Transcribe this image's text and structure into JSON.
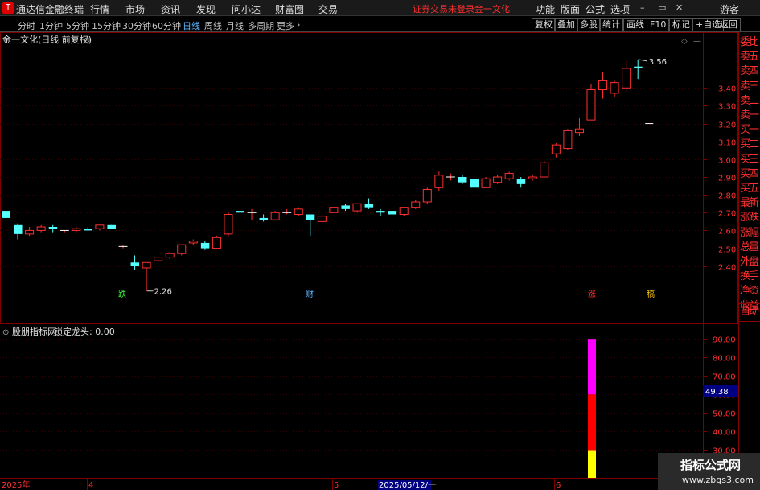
{
  "menubar": {
    "app_title": "通达信金融终端",
    "items": [
      "行情",
      "市场",
      "资讯",
      "发现",
      "问小达",
      "财富圈",
      "交易"
    ],
    "status": "证券交易未登录",
    "stock_name": "金一文化",
    "right_items": [
      "功能",
      "版面",
      "公式",
      "选项"
    ],
    "guest": "游客",
    "win_min": "–",
    "win_restore": "▭",
    "win_close": "✕"
  },
  "toolbar": {
    "periods": [
      "分时",
      "1分钟",
      "5分钟",
      "15分钟",
      "30分钟",
      "60分钟",
      "日线",
      "周线",
      "月线",
      "多周期",
      "更多"
    ],
    "active_period": "日线",
    "right_buttons": [
      "复权",
      "叠加",
      "多股",
      "统计",
      "画线",
      "F10",
      "标记",
      "+自选",
      "返回"
    ]
  },
  "main_chart": {
    "title": "金一文化(日线 前复权)",
    "y_ticks": [
      "3.40",
      "3.30",
      "3.20",
      "3.10",
      "3.00",
      "2.90",
      "2.80",
      "2.70",
      "2.60",
      "2.50",
      "2.40"
    ],
    "high_label": "3.56",
    "low_label": "2.26",
    "markers": [
      {
        "text": "跌",
        "color": "#3cff3c"
      },
      {
        "text": "财",
        "color": "#5ab4ff"
      },
      {
        "text": "涨",
        "color": "#ff3030"
      },
      {
        "text": "稿",
        "color": "#ffcc00"
      }
    ]
  },
  "indicator": {
    "name": "股朋指标网",
    "line_label": "锁定龙头: 0.00",
    "y_ticks": [
      "90.00",
      "80.00",
      "70.00",
      "60.00",
      "50.00",
      "40.00",
      "30.00"
    ],
    "current_value": "49.38",
    "bar_segments": [
      {
        "from": 0,
        "to": 30,
        "color": "#ffff00"
      },
      {
        "from": 30,
        "to": 60,
        "color": "#ff0000"
      },
      {
        "from": 60,
        "to": 90,
        "color": "#ff00ff"
      }
    ]
  },
  "date_axis": [
    "2025年",
    "4",
    "5",
    "2025/05/12/一",
    "6"
  ],
  "right_panel": [
    "委比",
    "卖五",
    "卖四",
    "卖三",
    "卖二",
    "卖一",
    "买一",
    "买二",
    "买三",
    "买四",
    "买五",
    "最新",
    "涨跌",
    "涨幅",
    "总量",
    "外盘",
    "换手",
    "净资",
    "收益",
    "自动"
  ],
  "watermark": {
    "line1": "指标公式网",
    "line2": "www.zbgs3.com"
  },
  "colors": {
    "up": "#ff3030",
    "down": "#54ffff",
    "grid": "#800000",
    "axis_text": "#ff3030",
    "bg": "#000000"
  },
  "chart_data": {
    "type": "candlestick",
    "ylim": [
      2.2,
      3.6
    ],
    "candles": [
      {
        "o": 2.71,
        "h": 2.74,
        "l": 2.66,
        "c": 2.67
      },
      {
        "o": 2.63,
        "h": 2.64,
        "l": 2.55,
        "c": 2.58
      },
      {
        "o": 2.58,
        "h": 2.62,
        "l": 2.57,
        "c": 2.6
      },
      {
        "o": 2.6,
        "h": 2.63,
        "l": 2.59,
        "c": 2.62
      },
      {
        "o": 2.62,
        "h": 2.63,
        "l": 2.59,
        "c": 2.61
      },
      {
        "o": 2.6,
        "h": 2.6,
        "l": 2.59,
        "c": 2.6
      },
      {
        "o": 2.6,
        "h": 2.62,
        "l": 2.59,
        "c": 2.61
      },
      {
        "o": 2.61,
        "h": 2.62,
        "l": 2.6,
        "c": 2.6
      },
      {
        "o": 2.61,
        "h": 2.63,
        "l": 2.6,
        "c": 2.63
      },
      {
        "o": 2.63,
        "h": 2.63,
        "l": 2.61,
        "c": 2.61
      },
      {
        "o": 2.51,
        "h": 2.52,
        "l": 2.5,
        "c": 2.51
      },
      {
        "o": 2.42,
        "h": 2.46,
        "l": 2.38,
        "c": 2.4
      },
      {
        "o": 2.39,
        "h": 2.42,
        "l": 2.26,
        "c": 2.42
      },
      {
        "o": 2.43,
        "h": 2.45,
        "l": 2.42,
        "c": 2.45
      },
      {
        "o": 2.45,
        "h": 2.48,
        "l": 2.44,
        "c": 2.47
      },
      {
        "o": 2.47,
        "h": 2.52,
        "l": 2.46,
        "c": 2.52
      },
      {
        "o": 2.53,
        "h": 2.55,
        "l": 2.52,
        "c": 2.54
      },
      {
        "o": 2.53,
        "h": 2.54,
        "l": 2.49,
        "c": 2.5
      },
      {
        "o": 2.5,
        "h": 2.57,
        "l": 2.5,
        "c": 2.56
      },
      {
        "o": 2.58,
        "h": 2.7,
        "l": 2.57,
        "c": 2.69
      },
      {
        "o": 2.71,
        "h": 2.74,
        "l": 2.68,
        "c": 2.7
      },
      {
        "o": 2.7,
        "h": 2.72,
        "l": 2.66,
        "c": 2.7
      },
      {
        "o": 2.67,
        "h": 2.69,
        "l": 2.65,
        "c": 2.66
      },
      {
        "o": 2.66,
        "h": 2.71,
        "l": 2.66,
        "c": 2.7
      },
      {
        "o": 2.7,
        "h": 2.72,
        "l": 2.69,
        "c": 2.7
      },
      {
        "o": 2.69,
        "h": 2.73,
        "l": 2.68,
        "c": 2.72
      },
      {
        "o": 2.69,
        "h": 2.69,
        "l": 2.57,
        "c": 2.66
      },
      {
        "o": 2.65,
        "h": 2.69,
        "l": 2.65,
        "c": 2.68
      },
      {
        "o": 2.7,
        "h": 2.73,
        "l": 2.7,
        "c": 2.73
      },
      {
        "o": 2.74,
        "h": 2.75,
        "l": 2.71,
        "c": 2.72
      },
      {
        "o": 2.71,
        "h": 2.75,
        "l": 2.7,
        "c": 2.75
      },
      {
        "o": 2.75,
        "h": 2.78,
        "l": 2.72,
        "c": 2.73
      },
      {
        "o": 2.71,
        "h": 2.72,
        "l": 2.68,
        "c": 2.7
      },
      {
        "o": 2.71,
        "h": 2.71,
        "l": 2.69,
        "c": 2.69
      },
      {
        "o": 2.69,
        "h": 2.73,
        "l": 2.68,
        "c": 2.73
      },
      {
        "o": 2.73,
        "h": 2.77,
        "l": 2.72,
        "c": 2.76
      },
      {
        "o": 2.76,
        "h": 2.84,
        "l": 2.75,
        "c": 2.83
      },
      {
        "o": 2.84,
        "h": 2.93,
        "l": 2.82,
        "c": 2.91
      },
      {
        "o": 2.9,
        "h": 2.92,
        "l": 2.88,
        "c": 2.9
      },
      {
        "o": 2.9,
        "h": 2.91,
        "l": 2.86,
        "c": 2.87
      },
      {
        "o": 2.89,
        "h": 2.9,
        "l": 2.83,
        "c": 2.84
      },
      {
        "o": 2.84,
        "h": 2.9,
        "l": 2.84,
        "c": 2.89
      },
      {
        "o": 2.87,
        "h": 2.91,
        "l": 2.86,
        "c": 2.9
      },
      {
        "o": 2.89,
        "h": 2.93,
        "l": 2.88,
        "c": 2.92
      },
      {
        "o": 2.89,
        "h": 2.9,
        "l": 2.84,
        "c": 2.86
      },
      {
        "o": 2.89,
        "h": 2.91,
        "l": 2.88,
        "c": 2.9
      },
      {
        "o": 2.9,
        "h": 2.99,
        "l": 2.9,
        "c": 2.98
      },
      {
        "o": 3.03,
        "h": 3.09,
        "l": 3.01,
        "c": 3.08
      },
      {
        "o": 3.06,
        "h": 3.17,
        "l": 3.05,
        "c": 3.16
      },
      {
        "o": 3.15,
        "h": 3.23,
        "l": 3.13,
        "c": 3.17
      },
      {
        "o": 3.22,
        "h": 3.42,
        "l": 3.22,
        "c": 3.39
      },
      {
        "o": 3.39,
        "h": 3.49,
        "l": 3.34,
        "c": 3.44
      },
      {
        "o": 3.37,
        "h": 3.44,
        "l": 3.35,
        "c": 3.43
      },
      {
        "o": 3.4,
        "h": 3.55,
        "l": 3.38,
        "c": 3.51
      },
      {
        "o": 3.52,
        "h": 3.56,
        "l": 3.45,
        "c": 3.51
      },
      {
        "o": 3.2,
        "h": 3.2,
        "l": 3.2,
        "c": 3.2
      }
    ]
  }
}
